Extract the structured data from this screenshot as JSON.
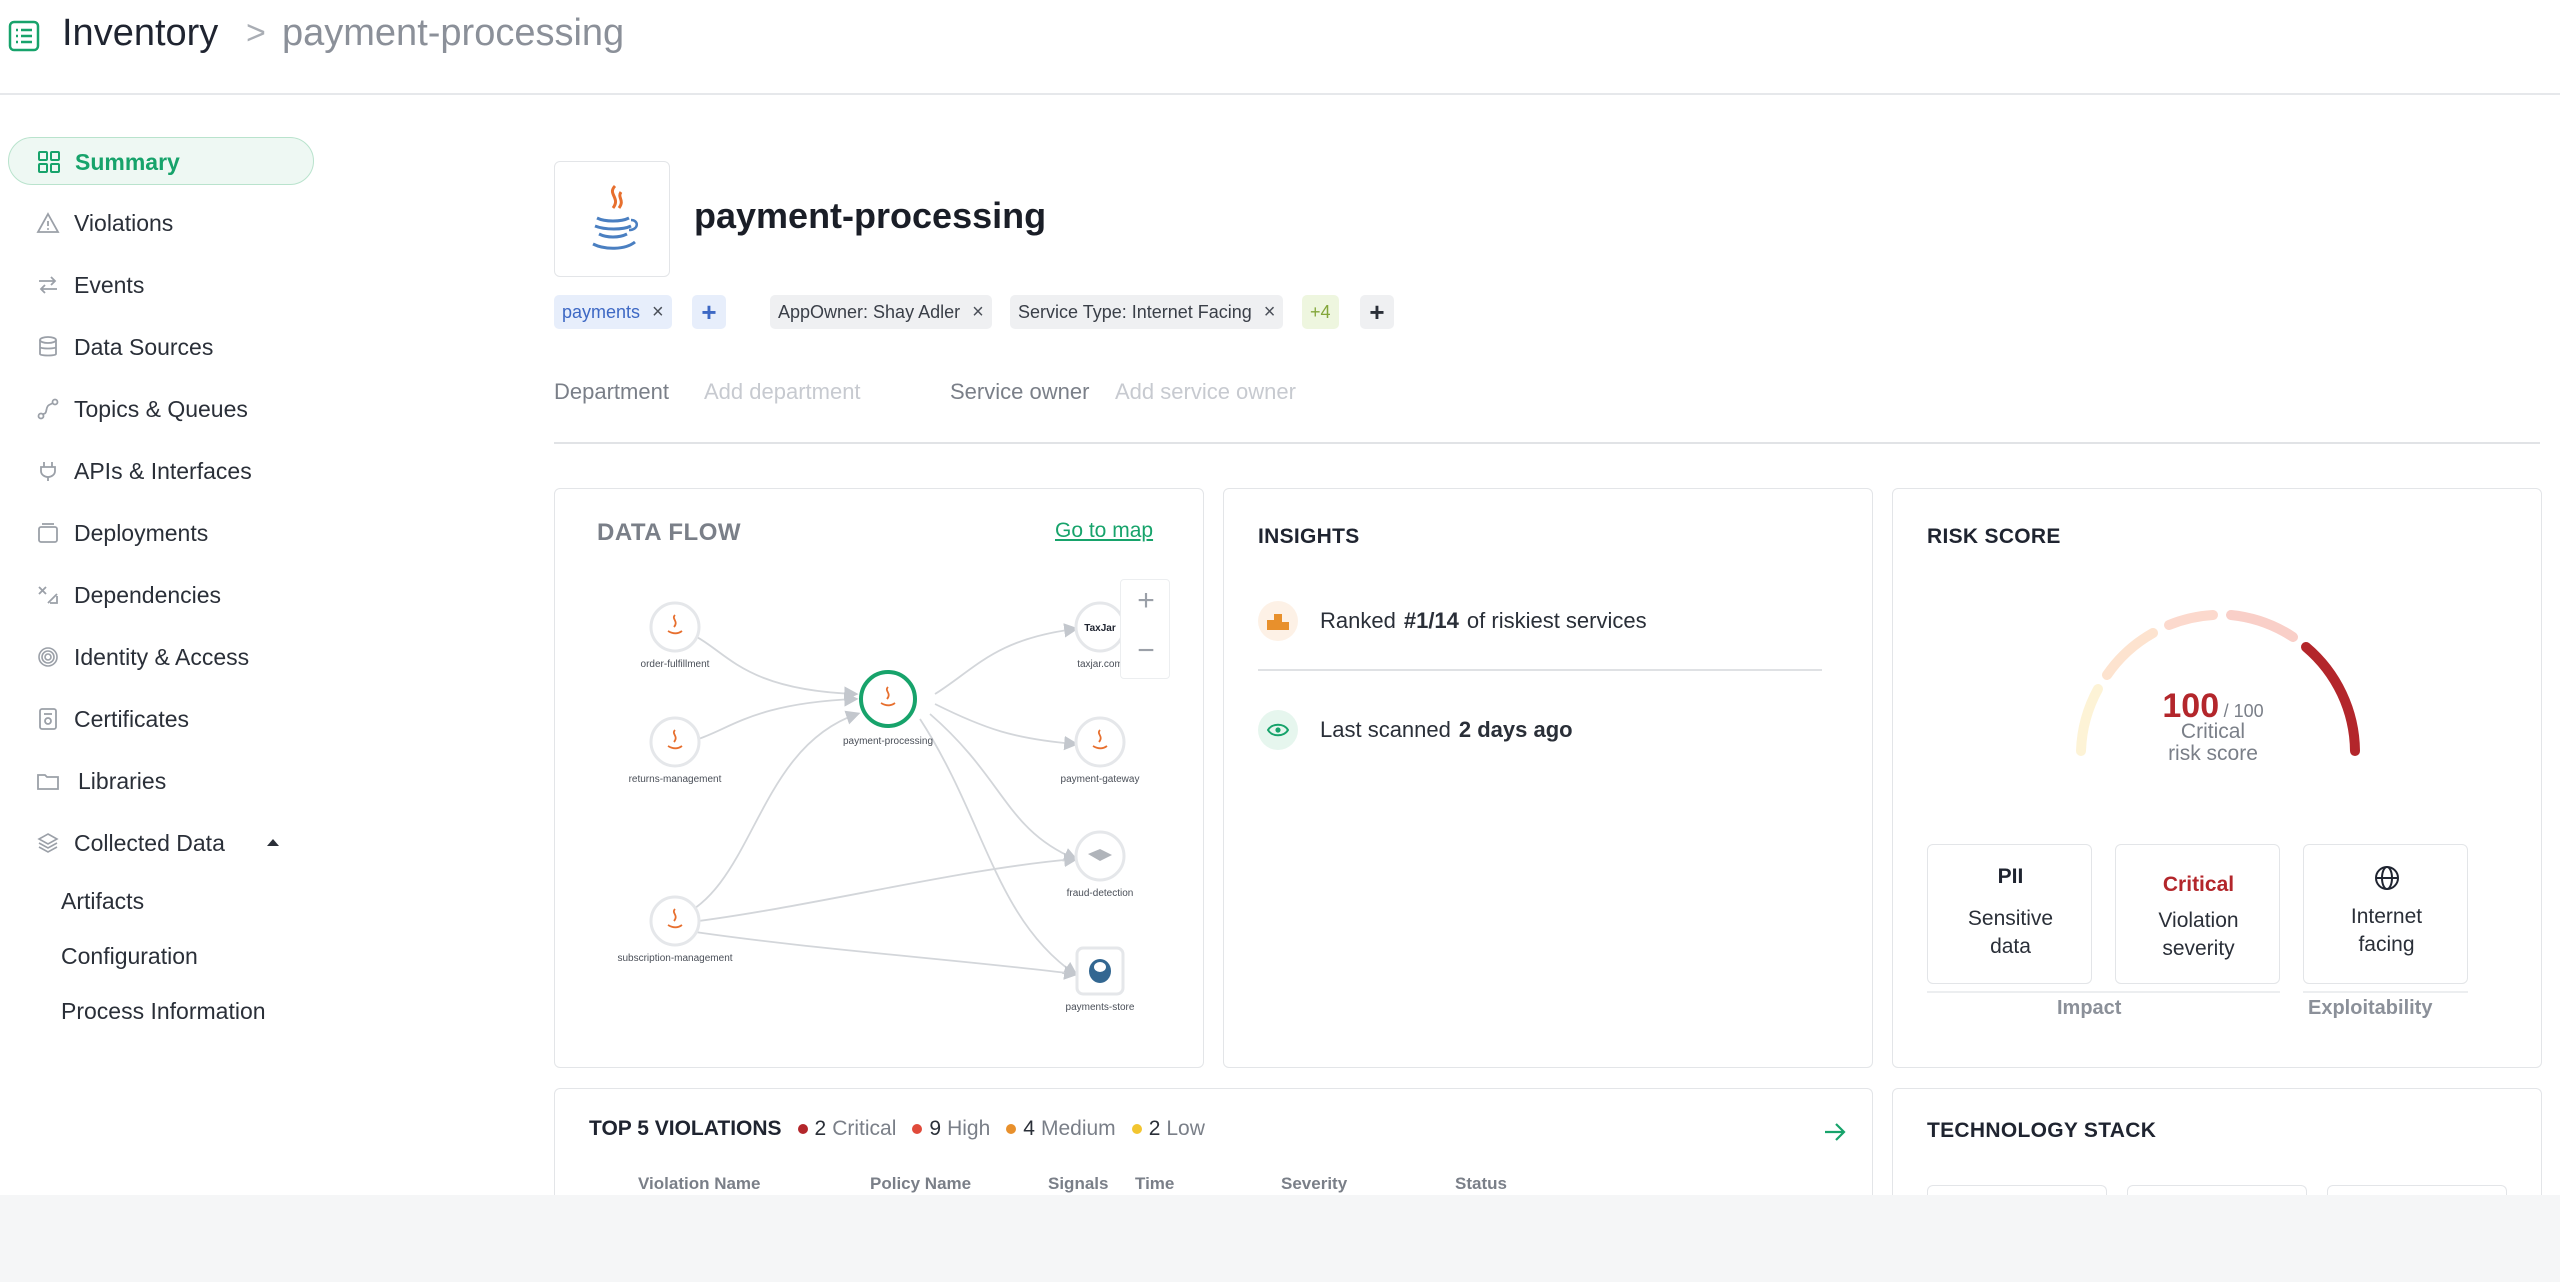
{
  "header": {
    "root": "Inventory",
    "separator": ">",
    "current": "payment-processing"
  },
  "sidebar": {
    "items": [
      {
        "label": "Summary",
        "icon": "grid-icon",
        "active": true
      },
      {
        "label": "Violations",
        "icon": "warning-icon"
      },
      {
        "label": "Events",
        "icon": "arrows-exchange-icon"
      },
      {
        "label": "Data Sources",
        "icon": "database-icon"
      },
      {
        "label": "Topics & Queues",
        "icon": "route-icon"
      },
      {
        "label": "APIs & Interfaces",
        "icon": "plug-icon"
      },
      {
        "label": "Deployments",
        "icon": "box-icon"
      },
      {
        "label": "Dependencies",
        "icon": "dependency-icon"
      },
      {
        "label": "Identity & Access",
        "icon": "fingerprint-icon"
      },
      {
        "label": "Certificates",
        "icon": "certificate-icon"
      },
      {
        "label": "Libraries",
        "icon": "folder-icon"
      },
      {
        "label": "Collected Data",
        "icon": "layers-icon",
        "expanded": true
      }
    ],
    "subitems": [
      "Artifacts",
      "Configuration",
      "Process Information"
    ]
  },
  "service": {
    "name": "payment-processing",
    "logo": "java-logo",
    "tags": [
      {
        "label": "payments"
      },
      {
        "label": "AppOwner: Shay Adler"
      },
      {
        "label": "Service Type: Internet Facing"
      }
    ],
    "more_tags": "+4",
    "add_symbol": "+",
    "remove_symbol": "×",
    "department_label": "Department",
    "department_placeholder": "Add department",
    "owner_label": "Service owner",
    "owner_placeholder": "Add service owner"
  },
  "dataflow": {
    "title": "DATA FLOW",
    "link": "Go to map",
    "zoom_in": "+",
    "zoom_out": "−",
    "nodes": {
      "order": "order-fulfillment",
      "returns": "returns-management",
      "subscription": "subscription-management",
      "center": "payment-processing",
      "taxjar": "taxjar.com",
      "gateway": "payment-gateway",
      "fraud": "fraud-detection",
      "store": "payments-store"
    }
  },
  "insights": {
    "title": "INSIGHTS",
    "ranked_prefix": "Ranked",
    "ranked_value": "#1/14",
    "ranked_suffix": "of riskiest services",
    "scanned_prefix": "Last scanned",
    "scanned_value": "2 days ago"
  },
  "risk": {
    "title": "RISK SCORE",
    "score": "100",
    "max": "/ 100",
    "level_line1": "Critical",
    "level_line2": "risk score",
    "score_fraction": 1.0,
    "boxes": [
      {
        "top": "PII",
        "line1": "Sensitive",
        "line2": "data"
      },
      {
        "top": "Critical",
        "line1": "Violation",
        "line2": "severity"
      },
      {
        "top_icon": "globe-icon",
        "line1": "Internet",
        "line2": "facing"
      }
    ],
    "impact_label": "Impact",
    "exploitability_label": "Exploitability",
    "colors": {
      "critical": "#b3262b"
    }
  },
  "violations": {
    "title": "TOP 5 VIOLATIONS",
    "counts": [
      {
        "n": "2",
        "label": "Critical",
        "color": "#b3262b"
      },
      {
        "n": "9",
        "label": "High",
        "color": "#e04a3a"
      },
      {
        "n": "4",
        "label": "Medium",
        "color": "#e8902c"
      },
      {
        "n": "2",
        "label": "Low",
        "color": "#f2c530"
      }
    ],
    "columns": [
      "Violation Name",
      "Policy Name",
      "Signals",
      "Time",
      "Severity",
      "Status"
    ]
  },
  "tech": {
    "title": "TECHNOLOGY STACK"
  }
}
